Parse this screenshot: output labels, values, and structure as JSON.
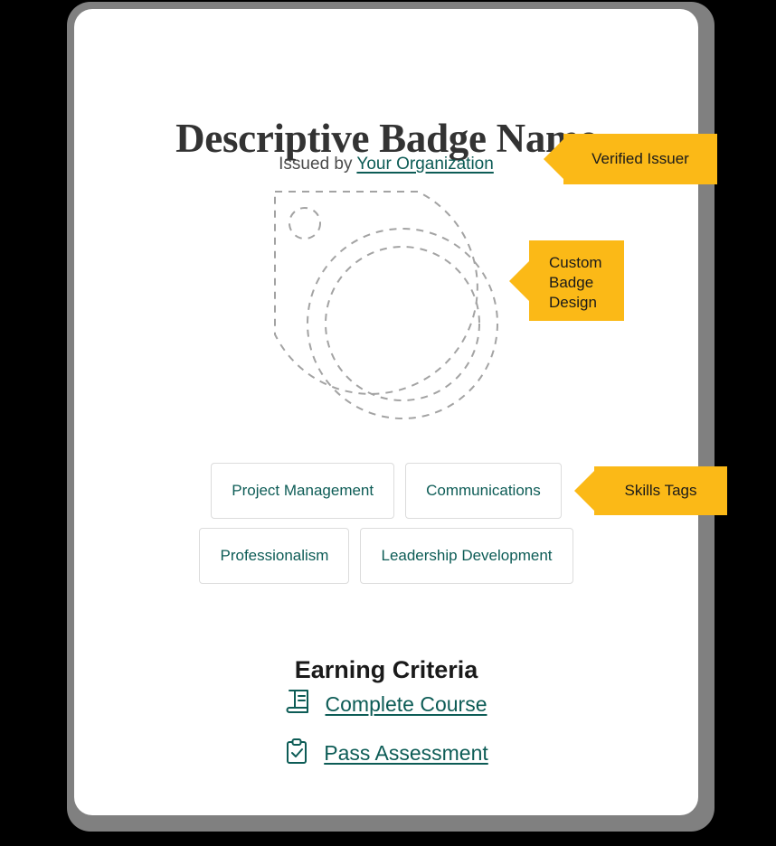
{
  "badge": {
    "title": "Descriptive Badge Name",
    "issued_by_prefix": "Issued by",
    "issuer_name": "Your Organization",
    "artwork_icon": "badge-placeholder-dashed-outline"
  },
  "skills": {
    "rows": [
      [
        {
          "label": "Project Management"
        },
        {
          "label": "Communications"
        }
      ],
      [
        {
          "label": "Professionalism"
        },
        {
          "label": "Leadership Development"
        }
      ]
    ]
  },
  "criteria": {
    "heading": "Earning Criteria",
    "items": [
      {
        "label": "Complete Course",
        "icon": "book-icon"
      },
      {
        "label": "Pass Assessment",
        "icon": "clipboard-check-icon"
      }
    ]
  },
  "callouts": {
    "verified": {
      "label": "Verified Issuer"
    },
    "design": {
      "line1": "Custom",
      "line2": "Badge",
      "line3": "Design"
    },
    "skills": {
      "label": "Skills Tags"
    }
  },
  "colors": {
    "accent_yellow": "#fbb917",
    "teal": "#0d5c56",
    "title_dark": "#333333",
    "card_background": "#ffffff",
    "page_background": "#000000",
    "card_shadow": "#808080",
    "tag_border": "#dcdcdc",
    "dashed_gray": "#a0a0a0"
  }
}
